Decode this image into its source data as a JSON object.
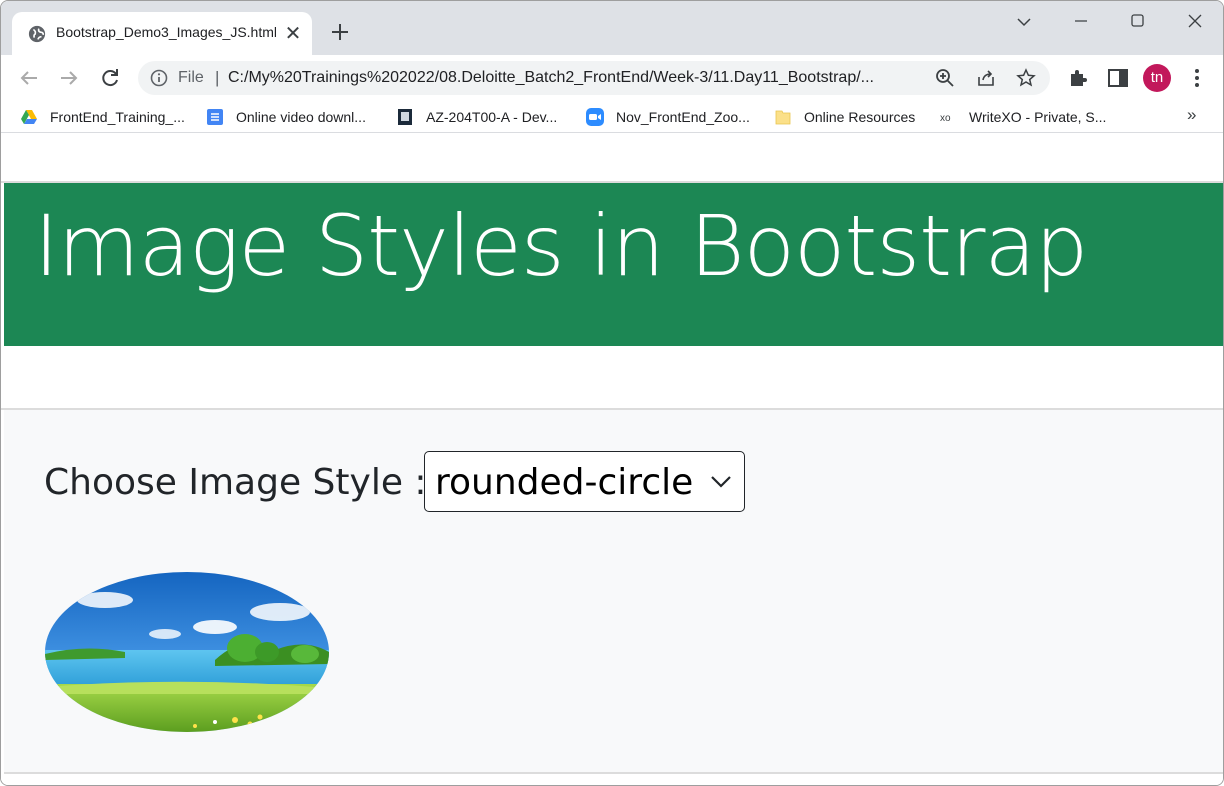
{
  "browser": {
    "tab": {
      "title": "Bootstrap_Demo3_Images_JS.html",
      "favicon": "globe-icon",
      "close_glyph": "✕"
    },
    "address": {
      "scheme_label": "File",
      "separator": "|",
      "url": "C:/My%20Trainings%202022/08.Deloitte_Batch2_FrontEnd/Week-3/11.Day11_Bootstrap/..."
    },
    "profile_initials": "tn",
    "profile_color": "#c2185b",
    "bookmarks": [
      {
        "label": "FrontEnd_Training_...",
        "icon": "google-drive-icon"
      },
      {
        "label": "Online video downl...",
        "icon": "list-doc-icon"
      },
      {
        "label": "AZ-204T00-A - Dev...",
        "icon": "book-icon"
      },
      {
        "label": "Nov_FrontEnd_Zoo...",
        "icon": "zoom-icon"
      },
      {
        "label": "Online Resources",
        "icon": "folder-icon"
      },
      {
        "label": "WriteXO - Private, S...",
        "icon": "xo-icon"
      }
    ],
    "bookmarks_more": "»"
  },
  "page": {
    "banner_title": "Image Styles in Bootstrap",
    "banner_color": "#1c8754",
    "choose_label": "Choose Image Style :",
    "style_select": {
      "selected": "rounded-circle"
    }
  }
}
